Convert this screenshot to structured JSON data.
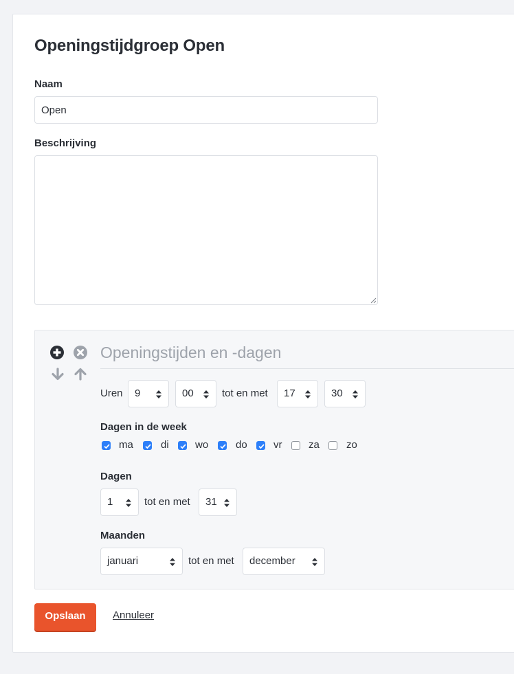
{
  "page": {
    "title": "Openingstijdgroep Open"
  },
  "form": {
    "name_label": "Naam",
    "name_value": "Open",
    "description_label": "Beschrijving",
    "description_value": ""
  },
  "opening_hours": {
    "section_title": "Openingstijden en -dagen",
    "icons": [
      "plus-circle-icon",
      "close-circle-icon",
      "arrow-down-icon",
      "arrow-up-icon"
    ],
    "hours": {
      "label": "Uren",
      "from_hour": "9",
      "from_minute": "00",
      "separator": "tot en met",
      "to_hour": "17",
      "to_minute": "30"
    },
    "weekdays": {
      "label": "Dagen in de week",
      "days": [
        {
          "label": "ma",
          "checked": true
        },
        {
          "label": "di",
          "checked": true
        },
        {
          "label": "wo",
          "checked": true
        },
        {
          "label": "do",
          "checked": true
        },
        {
          "label": "vr",
          "checked": true
        },
        {
          "label": "za",
          "checked": false
        },
        {
          "label": "zo",
          "checked": false
        }
      ]
    },
    "days": {
      "label": "Dagen",
      "from": "1",
      "separator": "tot en met",
      "to": "31"
    },
    "months": {
      "label": "Maanden",
      "from": "januari",
      "separator": "tot en met",
      "to": "december"
    }
  },
  "actions": {
    "save_label": "Opslaan",
    "cancel_label": "Annuleer"
  },
  "colors": {
    "accent": "#e9542c",
    "checkbox": "#2d7ff9",
    "page_background": "#f2f3f6",
    "panel_background": "#f6f7f9"
  }
}
